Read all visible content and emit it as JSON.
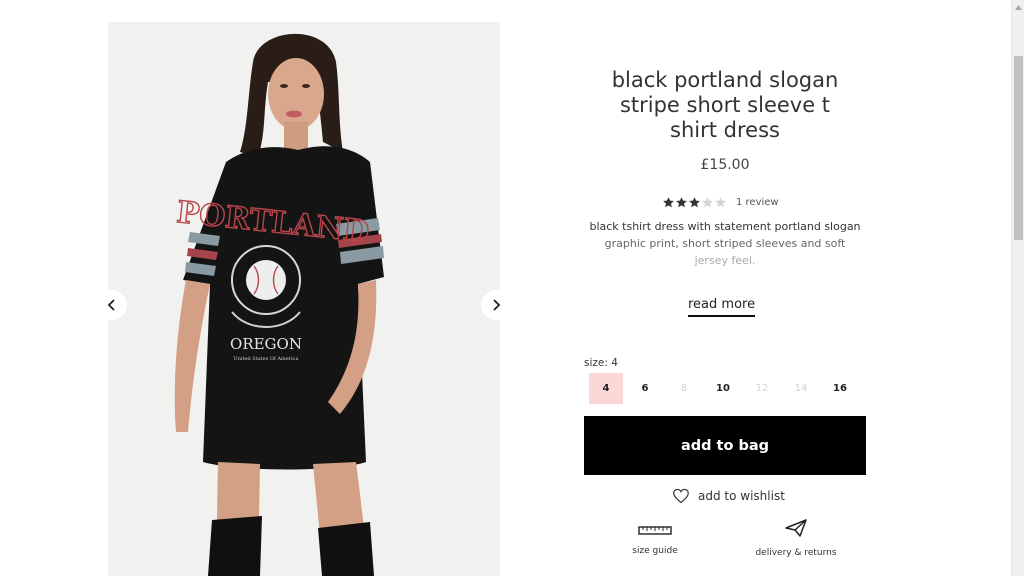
{
  "product": {
    "title": "black portland slogan stripe short sleeve t shirt dress",
    "price": "£15.00",
    "rating": {
      "stars_filled": 3,
      "stars_total": 5,
      "review_count": "1 review"
    },
    "description": {
      "line1": "black tshirt dress with statement portland slogan",
      "line2": "graphic print, short striped sleeves and soft",
      "line3": "jersey feel."
    },
    "read_more_label": "read more"
  },
  "image": {
    "print_word": "PORTLAND",
    "print_state": "OREGON",
    "print_sub": "United States Of America"
  },
  "size_selector": {
    "label": "size: 4",
    "sizes": [
      {
        "value": "4",
        "state": "selected"
      },
      {
        "value": "6",
        "state": "available"
      },
      {
        "value": "8",
        "state": "unavailable"
      },
      {
        "value": "10",
        "state": "available"
      },
      {
        "value": "12",
        "state": "unavailable"
      },
      {
        "value": "14",
        "state": "unavailable"
      },
      {
        "value": "16",
        "state": "available"
      }
    ]
  },
  "actions": {
    "add_to_bag": "add to bag",
    "add_to_wishlist": "add to wishlist",
    "size_guide": "size guide",
    "delivery_returns": "delivery & returns"
  },
  "colors": {
    "selected_size_bg": "#fbd7d5",
    "button_bg": "#000000",
    "print_red": "#b9454a"
  },
  "icons": {
    "prev": "chevron-left-icon",
    "next": "chevron-right-icon",
    "wishlist": "heart-icon",
    "size_guide": "ruler-icon",
    "delivery": "paper-plane-icon"
  }
}
